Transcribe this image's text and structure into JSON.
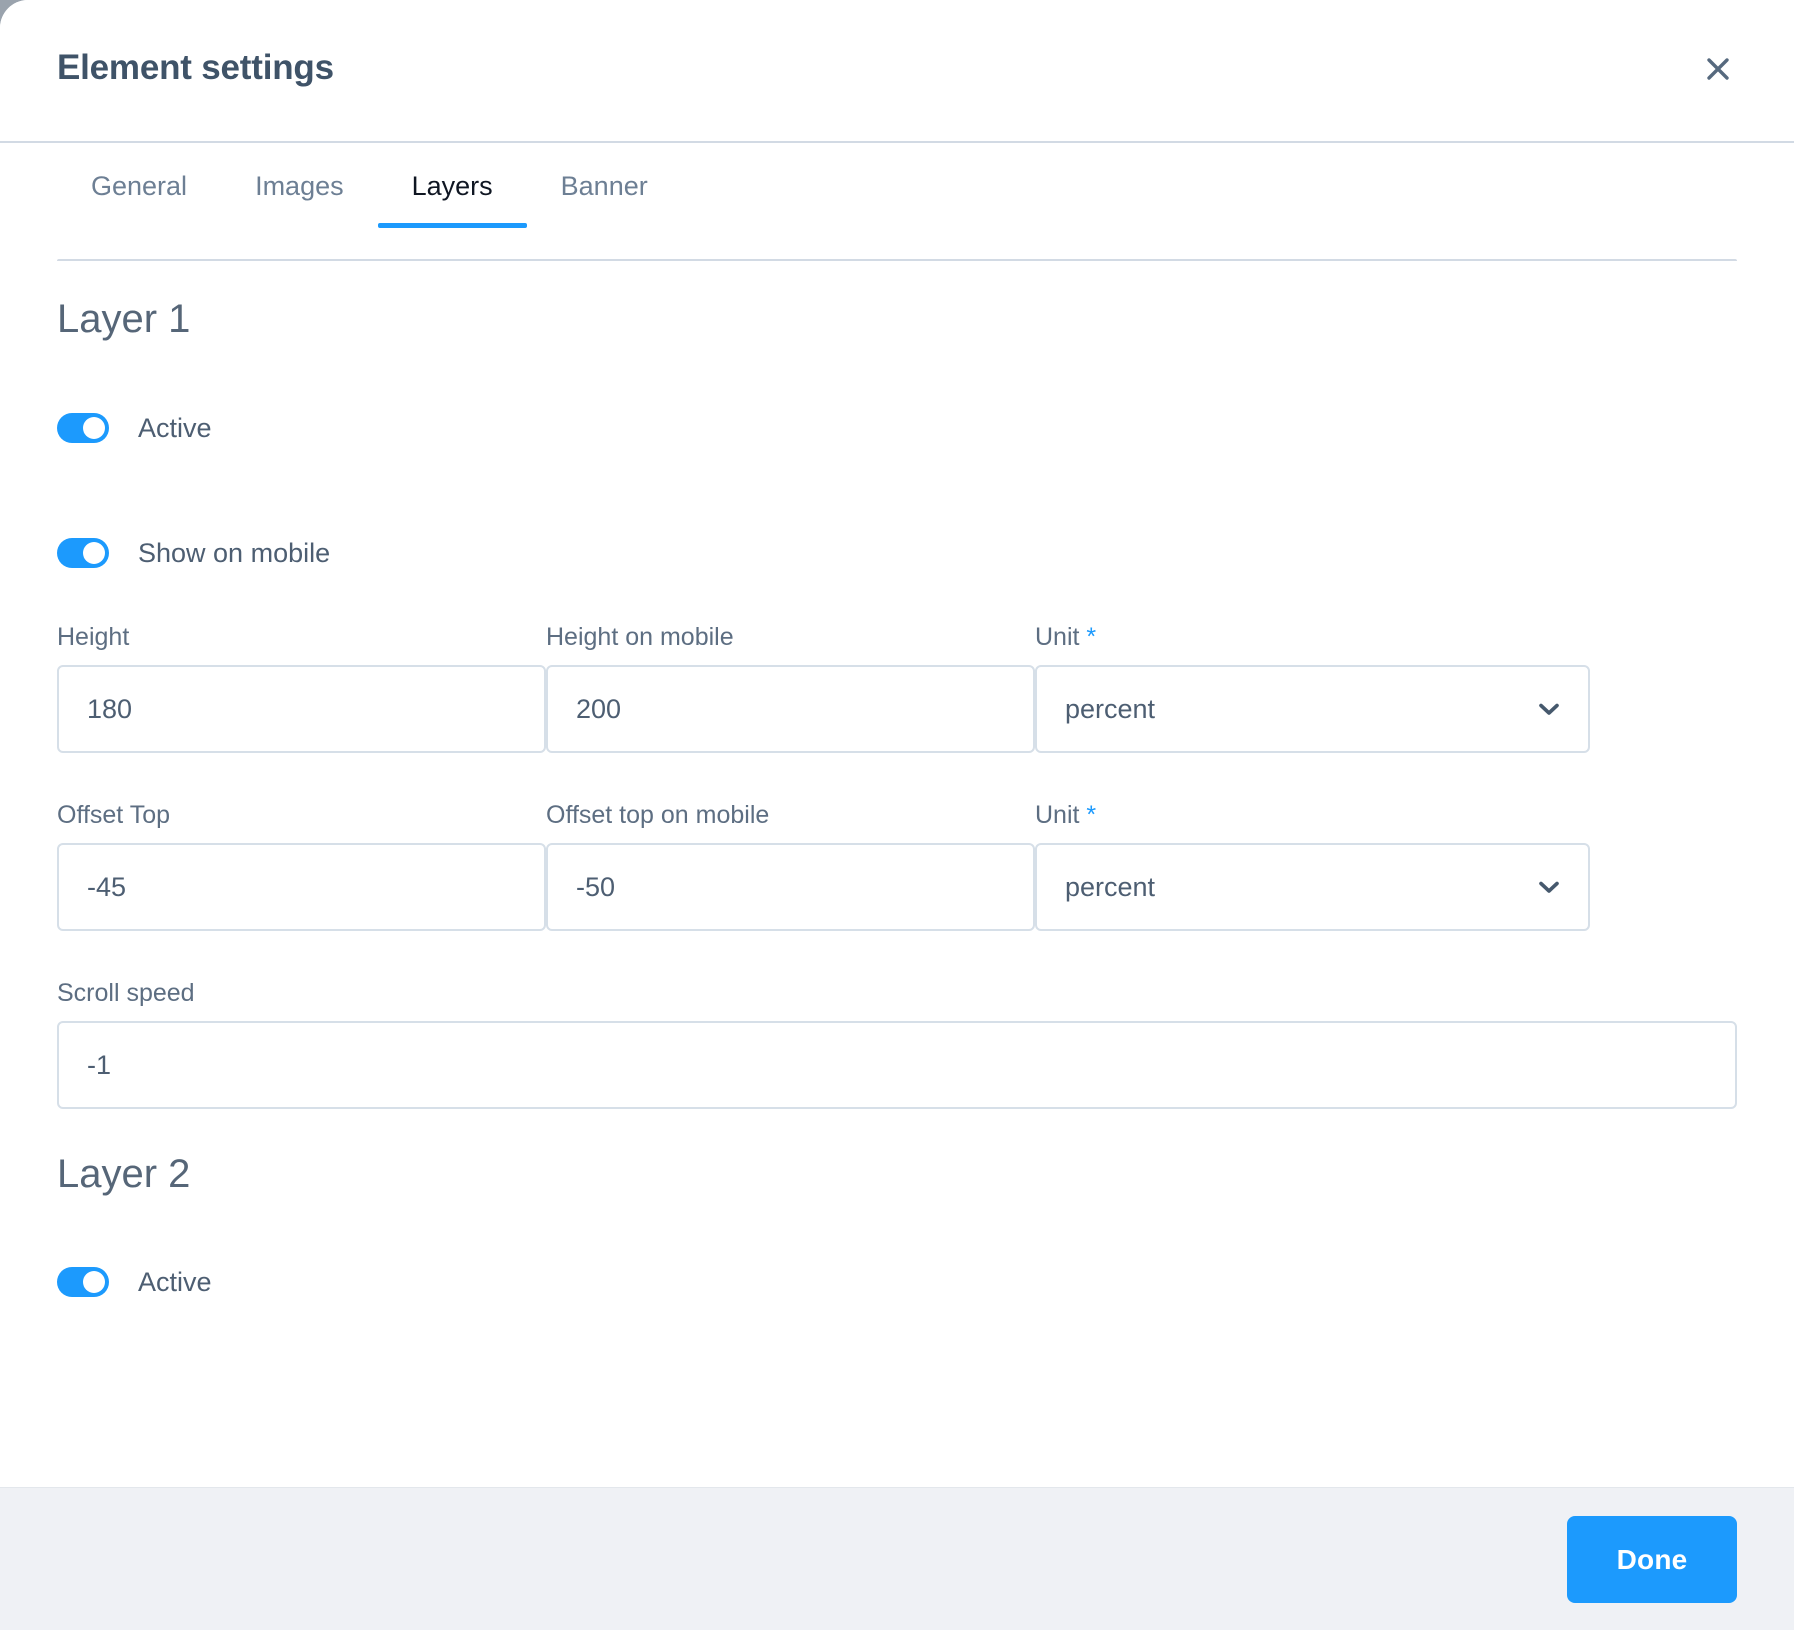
{
  "dialog": {
    "title": "Element settings",
    "close_icon": "close-icon"
  },
  "tabs": [
    {
      "label": "General",
      "active": false
    },
    {
      "label": "Images",
      "active": false
    },
    {
      "label": "Layers",
      "active": true
    },
    {
      "label": "Banner",
      "active": false
    }
  ],
  "layer1": {
    "title": "Layer 1",
    "active_toggle": {
      "label": "Active",
      "value": "on"
    },
    "mobile_toggle": {
      "label": "Show on mobile",
      "value": "on"
    },
    "height": {
      "label": "Height",
      "value": "180",
      "placeholder": ""
    },
    "height_mobile": {
      "label": "Height on mobile",
      "value": "200",
      "placeholder": ""
    },
    "height_unit": {
      "label": "Unit",
      "required_marker": "*",
      "value": "percent",
      "chevron_icon": "chevron-down-icon"
    },
    "offset_top": {
      "label": "Offset Top",
      "value": "-45",
      "placeholder": ""
    },
    "offset_top_mobile": {
      "label": "Offset top on mobile",
      "value": "-50",
      "placeholder": ""
    },
    "offset_unit": {
      "label": "Unit",
      "required_marker": "*",
      "value": "percent",
      "chevron_icon": "chevron-down-icon"
    },
    "scroll_speed": {
      "label": "Scroll speed",
      "value": "-1",
      "placeholder": ""
    }
  },
  "layer2": {
    "title": "Layer 2",
    "active_toggle": {
      "label": "Active",
      "value": "on"
    }
  },
  "footer": {
    "done_label": "Done"
  },
  "colors": {
    "accent": "#1c9afd",
    "title_text": "#3f5368",
    "label_text": "#5d6e82",
    "border": "#d6dfe8",
    "footer_bg": "#eff1f5",
    "backdrop": "#9aa3ad"
  }
}
